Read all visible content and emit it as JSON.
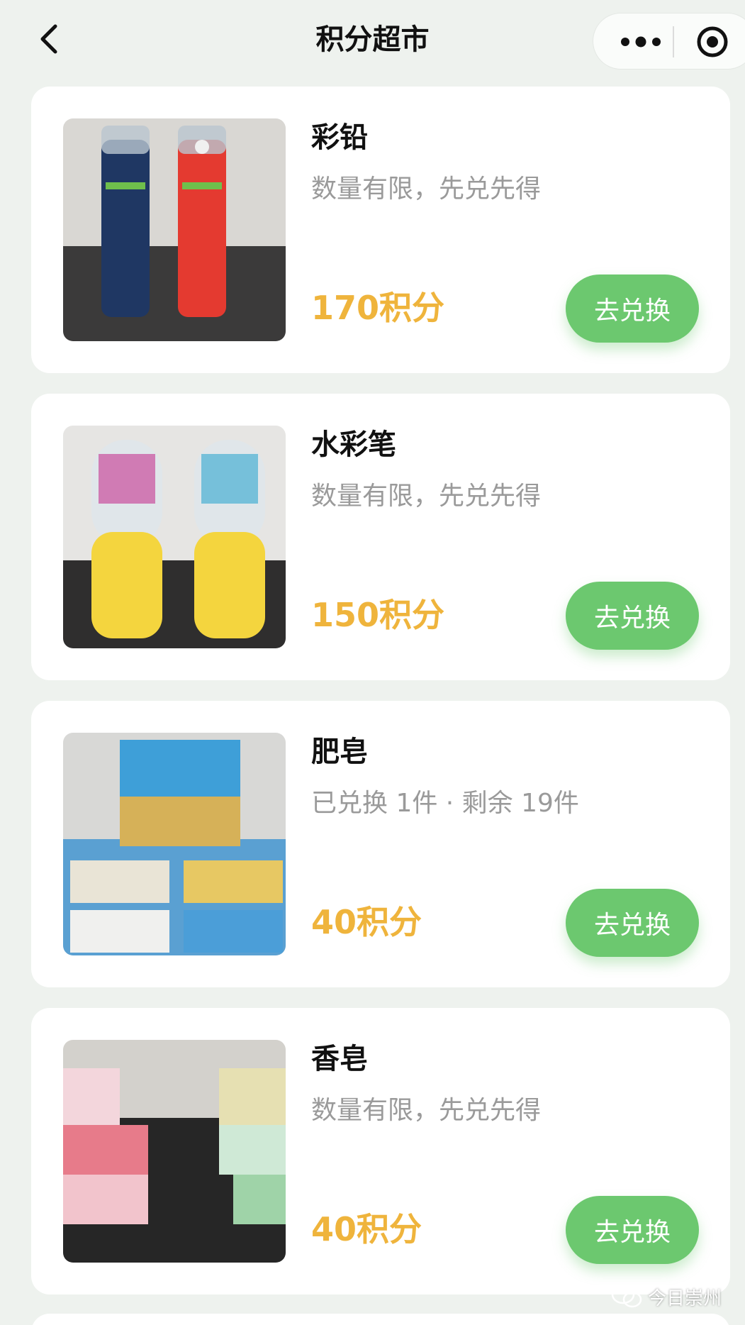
{
  "nav": {
    "title": "积分超市",
    "back_icon": "chevron-left-icon",
    "more_icon": "more-dots-icon",
    "close_icon": "target-circle-icon"
  },
  "products": [
    {
      "name": "彩铅",
      "desc": "数量有限，先兑先得",
      "price": "170积分",
      "button": "去兑换"
    },
    {
      "name": "水彩笔",
      "desc": "数量有限，先兑先得",
      "price": "150积分",
      "button": "去兑换"
    },
    {
      "name": "肥皂",
      "desc": "已兑换 1件 · 剩余 19件",
      "price": "40积分",
      "button": "去兑换"
    },
    {
      "name": "香皂",
      "desc": "数量有限，先兑先得",
      "price": "40积分",
      "button": "去兑换"
    }
  ],
  "watermark": {
    "text": "今日崇州"
  },
  "colors": {
    "accent_green": "#6cc86f",
    "price_orange": "#efb43c",
    "background": "#eef2ee"
  }
}
